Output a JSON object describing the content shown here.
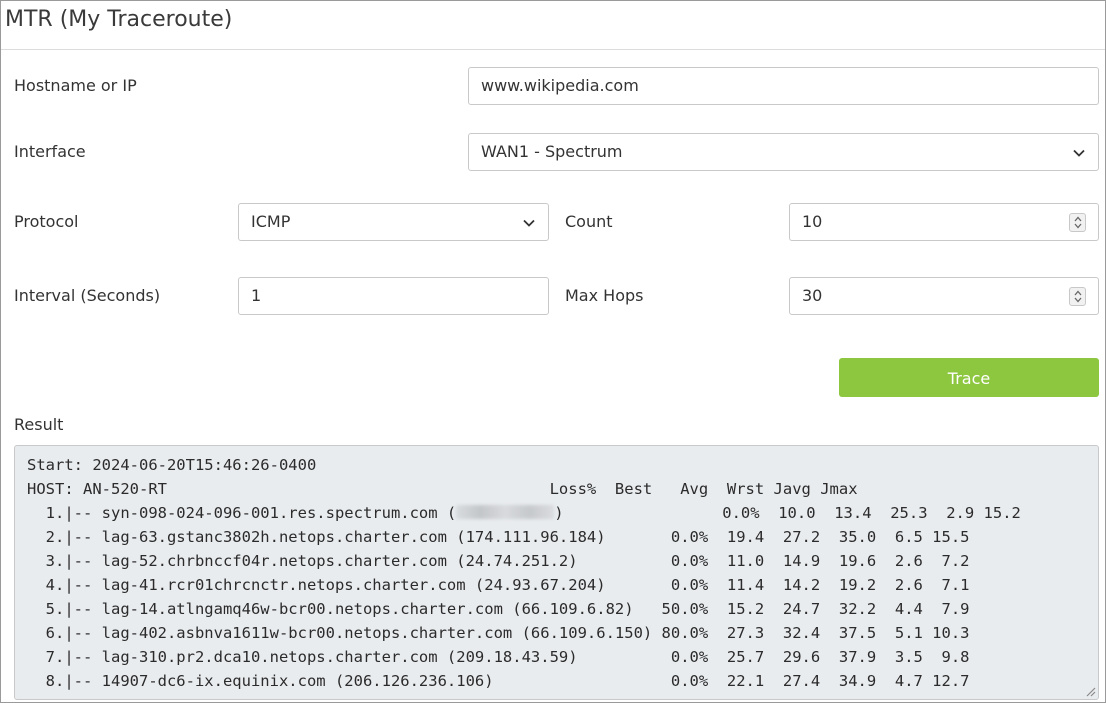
{
  "page": {
    "title": "MTR (My Traceroute)"
  },
  "form": {
    "hostname": {
      "label": "Hostname or IP",
      "value": "www.wikipedia.com"
    },
    "interface": {
      "label": "Interface",
      "value": "WAN1 - Spectrum"
    },
    "protocol": {
      "label": "Protocol",
      "value": "ICMP"
    },
    "count": {
      "label": "Count",
      "value": "10"
    },
    "interval": {
      "label": "Interval (Seconds)",
      "value": "1"
    },
    "max_hops": {
      "label": "Max Hops",
      "value": "30"
    },
    "trace_button": "Trace"
  },
  "result": {
    "label": "Result",
    "start_line": "Start: 2024-06-20T15:46:26-0400",
    "header_line": "HOST: AN-520-RT                                         Loss%  Best   Avg  Wrst Javg Jmax",
    "row1_prefix": "  1.|-- syn-098-024-096-001.res.spectrum.com (",
    "row1_suffix": ")                 0.0%  10.0  13.4  25.3  2.9 15.2",
    "rows": [
      "  2.|-- lag-63.gstanc3802h.netops.charter.com (174.111.96.184)       0.0%  19.4  27.2  35.0  6.5 15.5",
      "  3.|-- lag-52.chrbnccf04r.netops.charter.com (24.74.251.2)          0.0%  11.0  14.9  19.6  2.6  7.2",
      "  4.|-- lag-41.rcr01chrcnctr.netops.charter.com (24.93.67.204)       0.0%  11.4  14.2  19.2  2.6  7.1",
      "  5.|-- lag-14.atlngamq46w-bcr00.netops.charter.com (66.109.6.82)   50.0%  15.2  24.7  32.2  4.4  7.9",
      "  6.|-- lag-402.asbnva1611w-bcr00.netops.charter.com (66.109.6.150) 80.0%  27.3  32.4  37.5  5.1 10.3",
      "  7.|-- lag-310.pr2.dca10.netops.charter.com (209.18.43.59)          0.0%  25.7  29.6  37.9  3.5  9.8",
      "  8.|-- 14907-dc6-ix.equinix.com (206.126.236.106)                   0.0%  22.1  27.4  34.9  4.7 12.7"
    ]
  },
  "icons": {
    "select_arrow": "chevron-down-icon",
    "number_spinner": "spinner-icon",
    "textarea_resize": "resize-grip-icon"
  },
  "colors": {
    "primary_button": "#8dc63f",
    "result_background": "#e9ecef",
    "border": "#c9c9c9"
  }
}
